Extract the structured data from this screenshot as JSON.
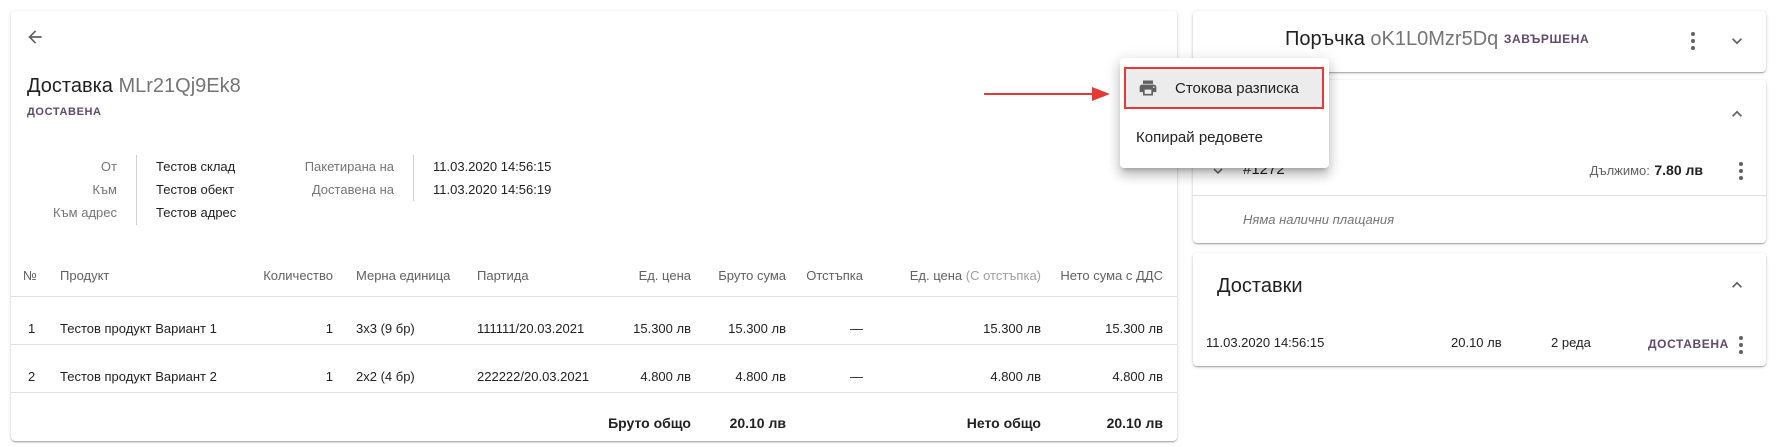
{
  "delivery": {
    "title": "Доставка",
    "id": "MLr21Qj9Ek8",
    "status": "ДОСТАВЕНА",
    "info_left": [
      {
        "label": "От",
        "value": "Тестов склад"
      },
      {
        "label": "Към",
        "value": "Тестов обект"
      },
      {
        "label": "Към адрес",
        "value": "Тестов адрес"
      }
    ],
    "info_right": [
      {
        "label": "Пакетирана на",
        "value": "11.03.2020 14:56:15"
      },
      {
        "label": "Доставена на",
        "value": "11.03.2020 14:56:19"
      }
    ],
    "table": {
      "headers": {
        "num": "№",
        "product": "Продукт",
        "qty": "Количество",
        "unit": "Мерна единица",
        "batch": "Партида",
        "unit_price": "Ед. цена",
        "gross": "Бруто сума",
        "discount": "Отстъпка",
        "unit_price_disc_main": "Ед. цена",
        "unit_price_disc_sub": "(С отстъпка)",
        "net_vat": "Нето сума с ДДС"
      },
      "rows": [
        {
          "num": "1",
          "product": "Тестов продукт Вариант 1",
          "qty": "1",
          "unit": "3x3 (9 бр)",
          "batch": "111111/20.03.2021",
          "unit_price": "15.300 лв",
          "gross": "15.300 лв",
          "discount": "—",
          "unit_price_disc": "15.300 лв",
          "net_vat": "15.300 лв"
        },
        {
          "num": "2",
          "product": "Тестов продукт Вариант 2",
          "qty": "1",
          "unit": "2x2 (4 бр)",
          "batch": "222222/20.03.2021",
          "unit_price": "4.800 лв",
          "gross": "4.800 лв",
          "discount": "—",
          "unit_price_disc": "4.800 лв",
          "net_vat": "4.800 лв"
        }
      ],
      "footer": {
        "gross_label": "Бруто общо",
        "gross_value": "20.10 лв",
        "net_label": "Нето общо",
        "net_value": "20.10 лв"
      }
    }
  },
  "context_menu": {
    "items": [
      {
        "label": "Стокова разписка",
        "icon": "printer-icon",
        "highlighted": true
      },
      {
        "label": "Копирай редовете"
      }
    ]
  },
  "order": {
    "title": "Поръчка",
    "id": "oK1L0Mzr5Dq",
    "status": "ЗАВЪРШЕНА"
  },
  "payments": {
    "invoice_id": "#1272",
    "due_label": "Дължимо:",
    "due_value": "7.80 лв",
    "empty_text": "Няма налични плащания"
  },
  "deliveries": {
    "title": "Доставки",
    "rows": [
      {
        "date": "11.03.2020 14:56:15",
        "amount": "20.10 лв",
        "lines": "2 реда",
        "status": "ДОСТАВЕНА"
      }
    ]
  },
  "colors": {
    "accent_purple": "#5e4a6b",
    "annotation_red": "#e53935",
    "id_grey": "#757575"
  }
}
